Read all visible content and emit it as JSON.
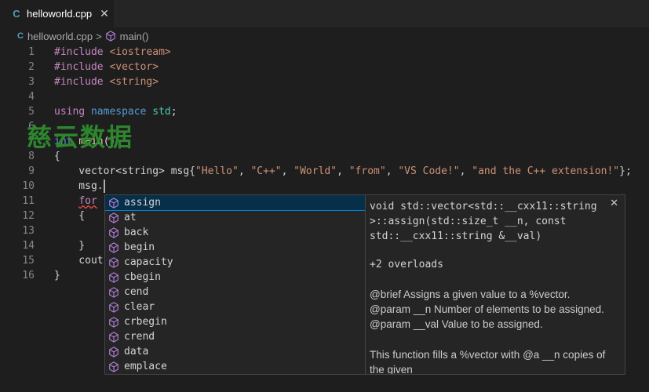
{
  "tab": {
    "filename": "helloworld.cpp",
    "icon": "cpp-file-icon",
    "close": "✕"
  },
  "breadcrumb": {
    "file": "helloworld.cpp",
    "separator": ">",
    "symbol": "main()"
  },
  "code_lines": [
    {
      "num": "1",
      "parts": [
        [
          "kw-dir",
          "#include "
        ],
        [
          "str",
          "<iostream>"
        ]
      ]
    },
    {
      "num": "2",
      "parts": [
        [
          "kw-dir",
          "#include "
        ],
        [
          "str",
          "<vector>"
        ]
      ]
    },
    {
      "num": "3",
      "parts": [
        [
          "kw-dir",
          "#include "
        ],
        [
          "str",
          "<string>"
        ]
      ]
    },
    {
      "num": "4",
      "parts": []
    },
    {
      "num": "5",
      "parts": [
        [
          "kw-dir",
          "using "
        ],
        [
          "kw",
          "namespace "
        ],
        [
          "ty",
          "std"
        ],
        [
          "plain",
          ";"
        ]
      ]
    },
    {
      "num": "6",
      "parts": []
    },
    {
      "num": "7",
      "parts": [
        [
          "kw",
          "int "
        ],
        [
          "fn",
          "main"
        ],
        [
          "plain",
          "()"
        ]
      ]
    },
    {
      "num": "8",
      "parts": [
        [
          "plain",
          "{"
        ]
      ]
    },
    {
      "num": "9",
      "parts": [
        [
          "plain",
          "    vector<string> msg{"
        ],
        [
          "str",
          "\"Hello\""
        ],
        [
          "plain",
          ", "
        ],
        [
          "str",
          "\"C++\""
        ],
        [
          "plain",
          ", "
        ],
        [
          "str",
          "\"World\""
        ],
        [
          "plain",
          ", "
        ],
        [
          "str",
          "\"from\""
        ],
        [
          "plain",
          ", "
        ],
        [
          "str",
          "\"VS Code!\""
        ],
        [
          "plain",
          ", "
        ],
        [
          "str",
          "\"and the C++ extension!\""
        ],
        [
          "plain",
          "};"
        ]
      ]
    },
    {
      "num": "10",
      "parts": [
        [
          "plain",
          "    msg."
        ]
      ],
      "cursor": true
    },
    {
      "num": "11",
      "parts": [
        [
          "plain",
          "    "
        ],
        [
          "kw-dir-sq",
          "for"
        ]
      ]
    },
    {
      "num": "12",
      "parts": [
        [
          "plain",
          "    {"
        ]
      ]
    },
    {
      "num": "13",
      "parts": []
    },
    {
      "num": "14",
      "parts": [
        [
          "plain",
          "    }"
        ]
      ]
    },
    {
      "num": "15",
      "parts": [
        [
          "plain",
          "    cout"
        ]
      ]
    },
    {
      "num": "16",
      "parts": [
        [
          "plain",
          "}"
        ]
      ]
    }
  ],
  "watermark": "慈云数据",
  "suggestions": [
    "assign",
    "at",
    "back",
    "begin",
    "capacity",
    "cbegin",
    "cend",
    "clear",
    "crbegin",
    "crend",
    "data",
    "emplace"
  ],
  "details": {
    "signature": "void std::vector<std::__cxx11::string >::assign(std::size_t __n, const std::__cxx11::string &__val)",
    "overloads": "+2 overloads",
    "doc_brief": "@brief Assigns a given value to a %vector.",
    "doc_param1": "@param __n Number of elements to be assigned.",
    "doc_param2": "@param __val Value to be assigned.",
    "doc_desc": "This function fills a %vector with @a __n copies of the given"
  },
  "colors": {
    "method_icon": "#b180d7",
    "selected_bg": "#062f4a",
    "focus_border": "#007fd4"
  }
}
